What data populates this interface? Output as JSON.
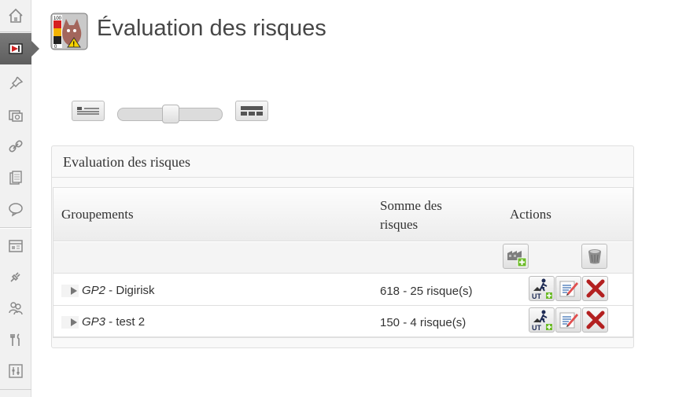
{
  "header": {
    "title": "Évaluation des risques",
    "icon": "risk-evaluation-app-icon"
  },
  "sidebar": {
    "items": [
      {
        "icon": "home-icon"
      },
      {
        "icon": "risk-evaluation-icon",
        "active": true
      },
      {
        "icon": "pin-icon"
      },
      {
        "icon": "media-icon"
      },
      {
        "icon": "link-icon"
      },
      {
        "icon": "pages-icon"
      },
      {
        "icon": "comments-icon"
      },
      {
        "icon": "appearance-icon"
      },
      {
        "icon": "plugins-icon"
      },
      {
        "icon": "users-icon"
      },
      {
        "icon": "tools-icon"
      },
      {
        "icon": "settings-icon"
      }
    ]
  },
  "view_toggle": {
    "left_icon": "list-view-icon",
    "right_icon": "table-view-icon",
    "slider_value": 0.5
  },
  "panel": {
    "title": "Evaluation des risques",
    "columns": [
      "Groupements",
      "Somme des risques",
      "Actions"
    ],
    "add_row_actions": [
      "add-group-icon",
      "trash-bin-icon"
    ],
    "rows": [
      {
        "ref": "GP2",
        "separator": " - ",
        "name": "Digirisk",
        "sum": "618 - 25 risque(s)"
      },
      {
        "ref": "GP3",
        "separator": " - ",
        "name": "test 2",
        "sum": "150 - 4 risque(s)"
      }
    ],
    "row_actions": [
      "add-work-unit-icon",
      "edit-icon",
      "delete-icon"
    ],
    "work_unit_badge": "UT"
  },
  "colors": {
    "sidebar_bg": "#f1f1f1",
    "active_menu": "#6a6a6a",
    "delete_red": "#b32020",
    "add_green": "#6dbb2a"
  }
}
